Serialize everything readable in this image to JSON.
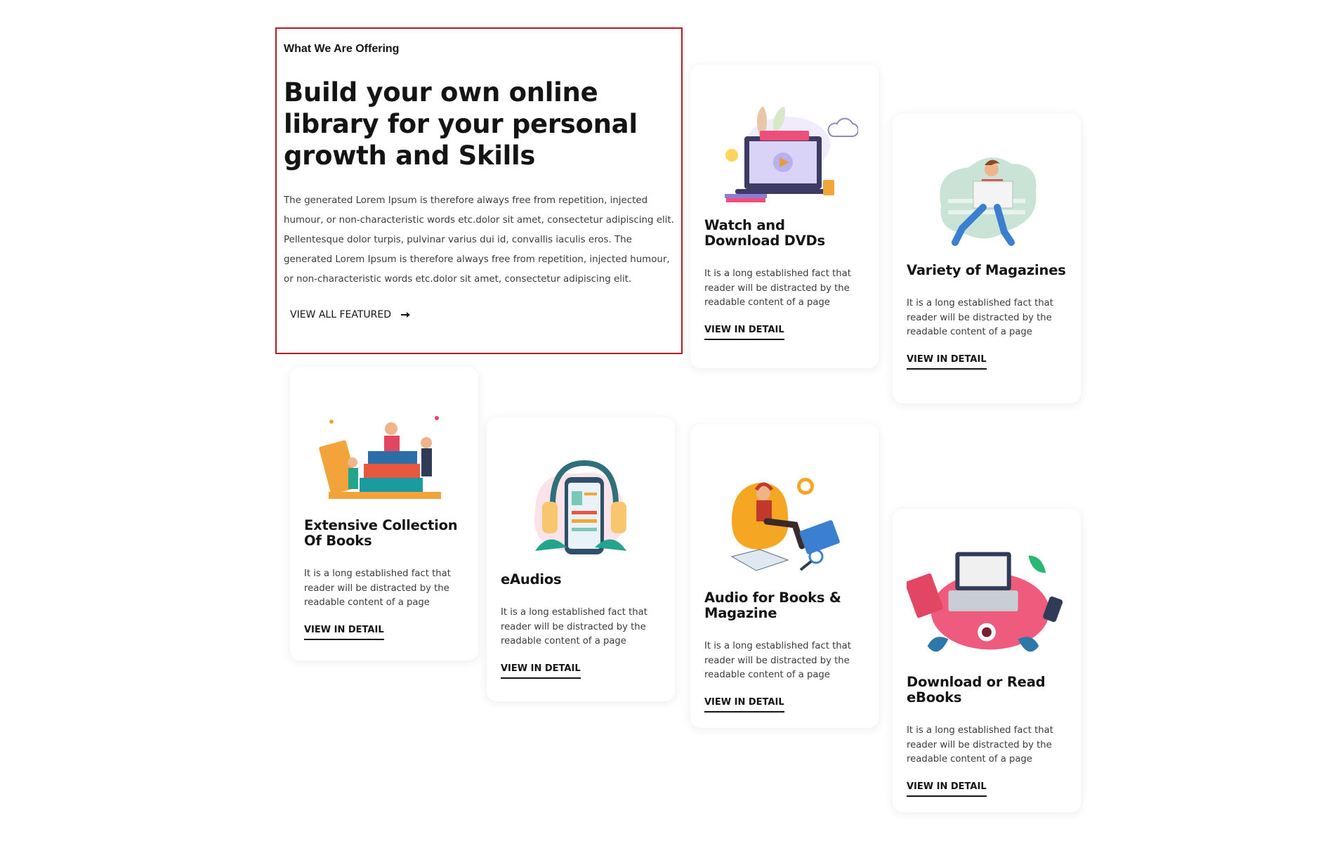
{
  "intro": {
    "eyebrow": "What We Are Offering",
    "headline": "Build your own online library for your personal growth and Skills",
    "body": "The generated Lorem Ipsum is therefore always free from repetition, injected humour, or non-characteristic words etc.dolor sit amet, consectetur adipiscing elit. Pellentesque dolor turpis, pulvinar varius dui id, convallis iaculis eros. The generated Lorem Ipsum is therefore always free from repetition, injected humour, or non-characteristic words etc.dolor sit amet, consectetur adipiscing elit.",
    "link_label": "VIEW ALL FEATURED",
    "arrow_icon": "arrow-right-icon"
  },
  "colors": {
    "frame": "#b71c24",
    "text": "#141414",
    "muted": "#3a3a3a"
  },
  "cards": [
    {
      "title": "Watch and Download DVDs",
      "text": "It is a long established fact that reader will be distracted by the readable content of a page",
      "link": "VIEW IN DETAIL",
      "icon": "laptop-video-illustration"
    },
    {
      "title": "Variety of Magazines",
      "text": "It is a long established fact that reader will be distracted by the readable content of a page",
      "link": "VIEW IN DETAIL",
      "icon": "man-reading-newspaper-illustration"
    },
    {
      "title": "Extensive Collection Of Books",
      "text": "It is a long established fact that reader will be distracted by the readable content of a page",
      "link": "VIEW IN DETAIL",
      "icon": "people-on-books-illustration"
    },
    {
      "title": "eAudios",
      "text": "It is a long established fact that reader will be distracted by the readable content of a page",
      "link": "VIEW IN DETAIL",
      "icon": "phone-headphones-illustration"
    },
    {
      "title": "Audio for Books & Magazine",
      "text": "It is a long established fact that reader will be distracted by the readable content of a page",
      "link": "VIEW IN DETAIL",
      "icon": "person-beanbag-listening-illustration"
    },
    {
      "title": "Download or Read eBooks",
      "text": "It is a long established fact that reader will be distracted by the readable content of a page",
      "link": "VIEW IN DETAIL",
      "icon": "desk-laptop-ebooks-illustration"
    }
  ]
}
